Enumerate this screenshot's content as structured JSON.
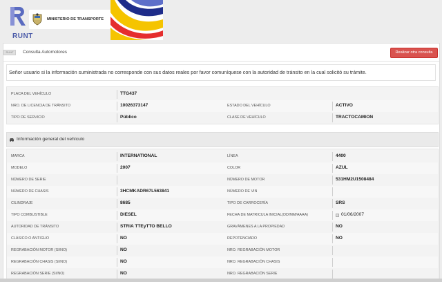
{
  "header": {
    "logo_text": "RUNT",
    "ministry_text": "MINISTERIO DE TRANSPORTE"
  },
  "toolbar": {
    "icon_text": "RUNT",
    "title": "Consulta Automotores",
    "action_button": "Realizar otra consulta"
  },
  "notice": "Señor usuario si la información suministrada no corresponde con sus datos reales por favor comuníquese con la autoridad de tránsito en la cual solicitó su trámite.",
  "summary": [
    {
      "label": "PLACA DEL VEHÍCULO",
      "value": "TTG437"
    },
    {
      "label": "NRO. DE LICENCIA DE TRÁNSITO",
      "value": "10026373147",
      "label2": "ESTADO DEL VEHÍCULO",
      "value2": "ACTIVO"
    },
    {
      "label": "TIPO DE SERVICIO",
      "value": "Público",
      "label2": "CLASE DE VEHÍCULO",
      "value2": "TRACTOCAMION"
    }
  ],
  "general_section_title": "Información general del vehículo",
  "general": [
    {
      "label": "MARCA",
      "value": "INTERNATIONAL",
      "label2": "LÍNEA",
      "value2": "4400"
    },
    {
      "label": "MODELO",
      "value": "2007",
      "label2": "COLOR",
      "value2": "AZUL"
    },
    {
      "label": "NÚMERO DE SERIE",
      "value": "",
      "label2": "NÚMERO DE MOTOR",
      "value2": "531HM2U1508484"
    },
    {
      "label": "NÚMERO DE CHASIS",
      "value": "3HCMKADR67L563841",
      "label2": "NÚMERO DE VIN",
      "value2": ""
    },
    {
      "label": "CILINDRAJE",
      "value": "8685",
      "label2": "TIPO DE CARROCERÍA",
      "value2": "SRS"
    },
    {
      "label": "TIPO COMBUSTIBLE",
      "value": "DIESEL",
      "label2": "FECHA DE MATRICULA INICIAL(DD/MM/AAAA)",
      "value2": "01/06/2007"
    },
    {
      "label": "AUTORIDAD DE TRÁNSITO",
      "value": "STRIA TTEyTTO BELLO",
      "label2": "GRAVÁMENES A LA PROPIEDAD",
      "value2": "NO"
    },
    {
      "label": "CLÁSICO O ANTIGUO",
      "value": "NO",
      "label2": "REPOTENCIADO",
      "value2": "NO"
    },
    {
      "label": "REGRABACIÓN MOTOR (SI/NO)",
      "value": "NO",
      "label2": "NRO. REGRABACIÓN MOTOR",
      "value2": ""
    },
    {
      "label": "REGRABACIÓN CHASIS (SI/NO)",
      "value": "NO",
      "label2": "NRO. REGRABACIÓN CHASIS",
      "value2": ""
    },
    {
      "label": "REGRABACIÓN SERIE (SI/NO)",
      "value": "NO",
      "label2": "NRO. REGRABACIÓN SERIE",
      "value2": ""
    }
  ],
  "colors": {
    "accent_button": "#d9534f",
    "runt_blue": "#4a5aa8"
  }
}
